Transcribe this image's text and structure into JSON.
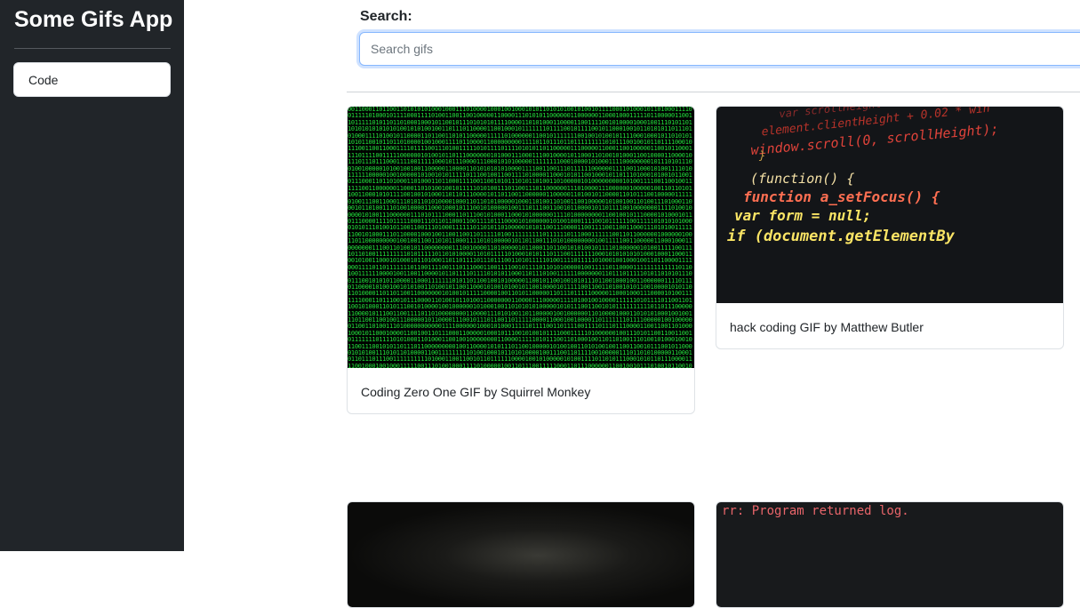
{
  "app": {
    "title": "Some Gifs App"
  },
  "sidebar": {
    "items": [
      {
        "label": "Code"
      }
    ]
  },
  "search": {
    "label": "Search:",
    "placeholder": "Search gifs",
    "value": ""
  },
  "gifs": [
    {
      "title": "Coding Zero One GIF by Squirrel Monkey"
    },
    {
      "title": "hack coding GIF by Matthew Butler",
      "image_text": [
        "var scrollHeight = window",
        "element.clientHeight + 0.02 * win",
        "window.scroll(0, scrollHeight);",
        "}",
        "(function() {",
        "function a_setFocus() {",
        "var form = null;",
        "if (document.getElementBy"
      ]
    },
    {
      "title": ""
    },
    {
      "title": "",
      "image_text": [
        "rr: Program returned log."
      ]
    }
  ],
  "colors": {
    "sidebar": "#212529",
    "matrix_green": "#22e03c",
    "accent_focus": "#86b7fe"
  }
}
